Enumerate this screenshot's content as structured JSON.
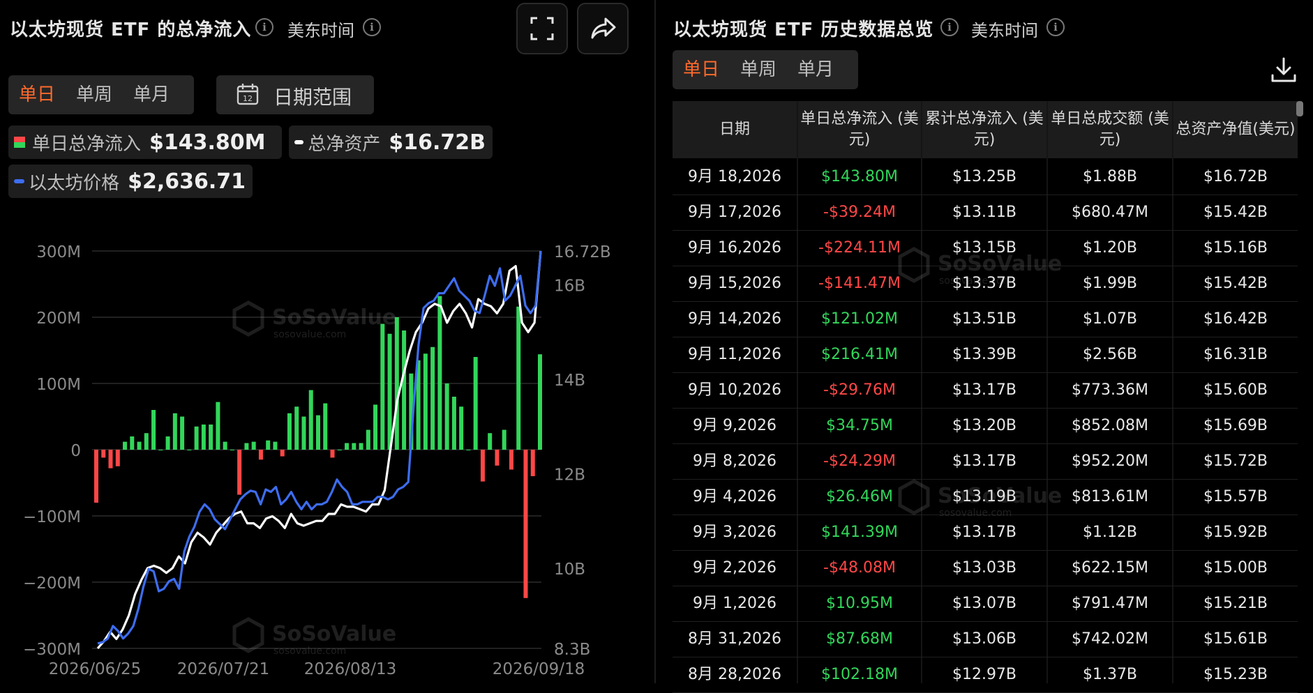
{
  "left_panel": {
    "title": "以太坊现货 ETF 的总净流入",
    "timezone": "美东时间",
    "period_tabs": [
      "单日",
      "单周",
      "单月"
    ],
    "active_tab": "单日",
    "date_range_label": "日期范围",
    "calendar_day": "12",
    "legend": {
      "daily_net_inflow": {
        "label": "单日总净流入",
        "value": "$143.80M"
      },
      "total_net_assets": {
        "label": "总净资产",
        "value": "$16.72B"
      },
      "eth_price": {
        "label": "以太坊价格",
        "value": "$2,636.71"
      }
    },
    "watermark": {
      "brand": "SoSoValue",
      "url": "sosovalue.com"
    }
  },
  "chart_data": {
    "type": "bar",
    "title": "",
    "left_axis_ticks": [
      "300M",
      "200M",
      "100M",
      "0",
      "−100M",
      "−200M",
      "−300M"
    ],
    "right_axis_ticks": [
      "16.72B",
      "16B",
      "14B",
      "12B",
      "10B",
      "8.3B"
    ],
    "x_tick_labels": [
      "2026/06/25",
      "2026/07/21",
      "2026/08/13",
      "2026/09/18"
    ],
    "ylim_left": [
      -300,
      300
    ],
    "ylim_right": [
      8.3,
      16.72
    ],
    "series": [
      {
        "name": "单日总净流入",
        "unit": "M",
        "color_positive": "#32d65a",
        "color_negative": "#ff4747",
        "values": [
          -80,
          -12,
          -28,
          -25,
          12,
          20,
          12,
          25,
          60,
          0,
          20,
          55,
          50,
          0,
          35,
          38,
          38,
          72,
          12,
          0,
          -68,
          10,
          12,
          -15,
          14,
          12,
          -10,
          55,
          65,
          50,
          90,
          52,
          70,
          -12,
          0,
          10,
          10,
          10,
          30,
          68,
          190,
          175,
          200,
          180,
          115,
          135,
          145,
          155,
          232,
          100,
          80,
          65,
          0,
          140,
          -48,
          25,
          -24,
          30,
          -30,
          216,
          -224,
          -40,
          144
        ]
      },
      {
        "name": "总净资产",
        "unit": "B",
        "color": "#ffffff",
        "values": [
          8.3,
          8.45,
          8.65,
          8.5,
          8.7,
          9.0,
          9.45,
          9.75,
          10.0,
          10.05,
          10.0,
          9.9,
          10.0,
          10.25,
          10.1,
          10.55,
          10.75,
          10.65,
          10.5,
          10.75,
          10.9,
          11.05,
          11.15,
          11.2,
          10.95,
          10.95,
          10.85,
          11.05,
          11.1,
          11.0,
          10.85,
          11.15,
          10.95,
          10.9,
          10.95,
          11.0,
          11.0,
          11.15,
          11.15,
          11.35,
          11.3,
          11.3,
          11.25,
          11.2,
          11.35,
          11.35,
          11.65,
          12.6,
          13.55,
          14.1,
          14.6,
          15.0,
          15.2,
          15.5,
          15.6,
          15.55,
          15.2,
          15.45,
          15.6,
          15.4,
          15.1,
          15.7,
          15.6,
          15.55,
          15.4,
          15.6,
          16.3,
          16.4,
          15.2,
          15.0,
          15.2,
          16.72
        ]
      },
      {
        "name": "以太坊价格",
        "color": "#3d6df0",
        "values": [
          2220,
          2225,
          2240,
          2290,
          2270,
          2240,
          2260,
          2290,
          2360,
          2450,
          2520,
          2510,
          2430,
          2440,
          2470,
          2480,
          2440,
          2590,
          2650,
          2690,
          2750,
          2780,
          2760,
          2720,
          2700,
          2680,
          2720,
          2760,
          2800,
          2820,
          2835,
          2830,
          2780,
          2840,
          2830,
          2850,
          2780,
          2800,
          2830,
          2790,
          2760,
          2790,
          2760,
          2780,
          2780,
          2790,
          2830,
          2880,
          2850,
          2830,
          2780,
          2780,
          2790,
          2790,
          2790,
          2810,
          2810,
          2800,
          2810,
          2840,
          2850,
          2870,
          3160,
          3420,
          3570,
          3590,
          3600,
          3630,
          3630,
          3660,
          3690,
          3640,
          3620,
          3600,
          3560,
          3550,
          3620,
          3700,
          3660,
          3730,
          3600,
          3620,
          3660,
          3700,
          3580,
          3550,
          3580,
          3800
        ]
      }
    ]
  },
  "right_panel": {
    "title": "以太坊现货 ETF 历史数据总览",
    "timezone": "美东时间",
    "period_tabs": [
      "单日",
      "单周",
      "单月"
    ],
    "active_tab": "单日",
    "columns": [
      "日期",
      "单日总净流入 (美元)",
      "累计总净流入 (美元)",
      "单日总成交额 (美元)",
      "总资产净值(美元)"
    ],
    "rows": [
      {
        "date": "9月 18,2026",
        "daily": "$143.80M",
        "sign": "pos",
        "cum": "$13.25B",
        "vol": "$1.88B",
        "nav": "$16.72B"
      },
      {
        "date": "9月 17,2026",
        "daily": "-$39.24M",
        "sign": "neg",
        "cum": "$13.11B",
        "vol": "$680.47M",
        "nav": "$15.42B"
      },
      {
        "date": "9月 16,2026",
        "daily": "-$224.11M",
        "sign": "neg",
        "cum": "$13.15B",
        "vol": "$1.20B",
        "nav": "$15.16B"
      },
      {
        "date": "9月 15,2026",
        "daily": "-$141.47M",
        "sign": "neg",
        "cum": "$13.37B",
        "vol": "$1.99B",
        "nav": "$15.42B"
      },
      {
        "date": "9月 14,2026",
        "daily": "$121.02M",
        "sign": "pos",
        "cum": "$13.51B",
        "vol": "$1.07B",
        "nav": "$16.42B"
      },
      {
        "date": "9月 11,2026",
        "daily": "$216.41M",
        "sign": "pos",
        "cum": "$13.39B",
        "vol": "$2.56B",
        "nav": "$16.31B"
      },
      {
        "date": "9月 10,2026",
        "daily": "-$29.76M",
        "sign": "neg",
        "cum": "$13.17B",
        "vol": "$773.36M",
        "nav": "$15.60B"
      },
      {
        "date": "9月 9,2026",
        "daily": "$34.75M",
        "sign": "pos",
        "cum": "$13.20B",
        "vol": "$852.08M",
        "nav": "$15.69B"
      },
      {
        "date": "9月 8,2026",
        "daily": "-$24.29M",
        "sign": "neg",
        "cum": "$13.17B",
        "vol": "$952.20M",
        "nav": "$15.72B"
      },
      {
        "date": "9月 4,2026",
        "daily": "$26.46M",
        "sign": "pos",
        "cum": "$13.19B",
        "vol": "$813.61M",
        "nav": "$15.57B"
      },
      {
        "date": "9月 3,2026",
        "daily": "$141.39M",
        "sign": "pos",
        "cum": "$13.17B",
        "vol": "$1.12B",
        "nav": "$15.92B"
      },
      {
        "date": "9月 2,2026",
        "daily": "-$48.08M",
        "sign": "neg",
        "cum": "$13.03B",
        "vol": "$622.15M",
        "nav": "$15.00B"
      },
      {
        "date": "9月 1,2026",
        "daily": "$10.95M",
        "sign": "pos",
        "cum": "$13.07B",
        "vol": "$791.47M",
        "nav": "$15.21B"
      },
      {
        "date": "8月 31,2026",
        "daily": "$87.68M",
        "sign": "pos",
        "cum": "$13.06B",
        "vol": "$742.02M",
        "nav": "$15.61B"
      },
      {
        "date": "8月 28,2026",
        "daily": "$102.18M",
        "sign": "pos",
        "cum": "$12.97B",
        "vol": "$1.37B",
        "nav": "$15.23B"
      }
    ]
  }
}
